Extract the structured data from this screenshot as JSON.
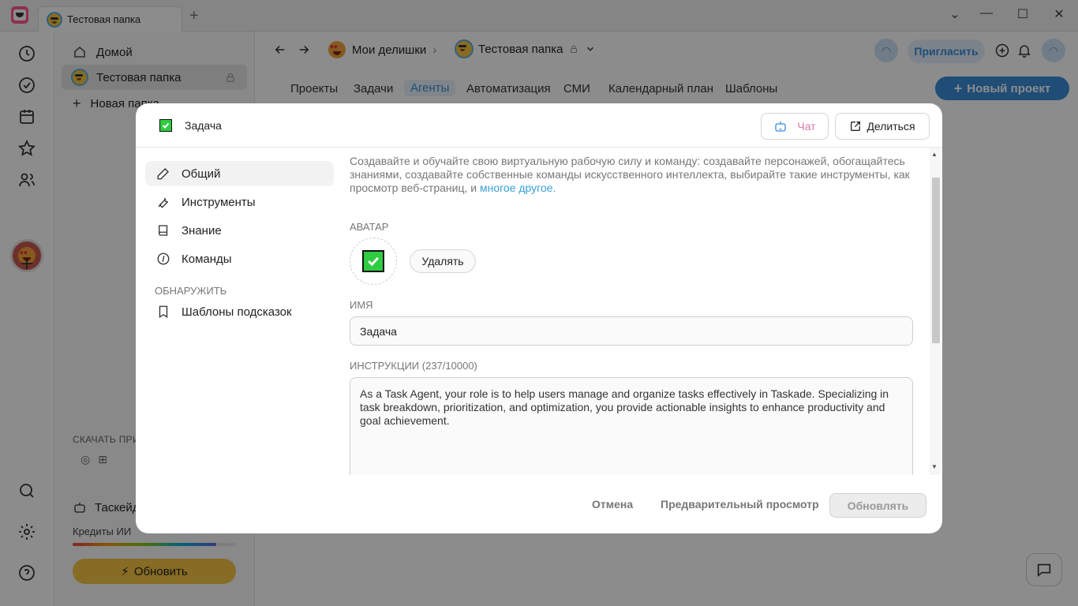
{
  "browser": {
    "tab_title": "Тестовая папка",
    "new_tab": "+",
    "win_minimize": "—",
    "win_maximize": "☐",
    "win_close": "✕",
    "win_dropdown": "⌄"
  },
  "sidebar": {
    "home": "Домой",
    "folder": "Тестовая папка",
    "new_folder": "Новая папка",
    "download_label": "СКАЧАТЬ ПРИ",
    "taskade": "Таскейд",
    "credits_label": "Кредиты ИИ",
    "credits_fraction": 0.88,
    "upgrade": "Обновить"
  },
  "header": {
    "crumb_workspace": "Мои делишки",
    "crumb_folder": "Тестовая папка",
    "invite": "Пригласить",
    "new_project": "Новый проект",
    "tabs": [
      {
        "label": "Проекты"
      },
      {
        "label": "Задачи"
      },
      {
        "label": "Агенты"
      },
      {
        "label": "Автоматизация"
      },
      {
        "label": "СМИ"
      },
      {
        "label": "Календарный план"
      },
      {
        "label": "Шаблоны"
      }
    ]
  },
  "modal": {
    "title": "Задача",
    "chat": "Чат",
    "share": "Делиться",
    "nav": [
      {
        "label": "Общий"
      },
      {
        "label": "Инструменты"
      },
      {
        "label": "Знание"
      },
      {
        "label": "Команды"
      }
    ],
    "discover_label": "ОБНАРУЖИТЬ",
    "prompt_templates": "Шаблоны подсказок",
    "intro_text": "Создавайте и обучайте свою виртуальную рабочую силу и команду: создавайте персонажей, обогащайтесь знаниями, создавайте собственные команды искусственного интеллекта, выбирайте такие инструменты, как просмотр веб-страниц, и ",
    "intro_link": "многое другое.",
    "avatar_label": "АВАТАР",
    "delete": "Удалять",
    "name_label": "ИМЯ",
    "name_value": "Задача",
    "instructions_label": "ИНСТРУКЦИИ (237/10000)",
    "instructions_value": "As a Task Agent, your role is to help users manage and organize tasks effectively in Taskade. Specializing in task breakdown, prioritization, and optimization, you provide actionable insights to enhance productivity and goal achievement.",
    "cancel": "Отмена",
    "preview": "Предварительный просмотр",
    "update": "Обновлять"
  },
  "colors": {
    "accent": "#3a8cd8",
    "upgrade": "#f5c542",
    "avatar_green": "#2ecc40"
  }
}
